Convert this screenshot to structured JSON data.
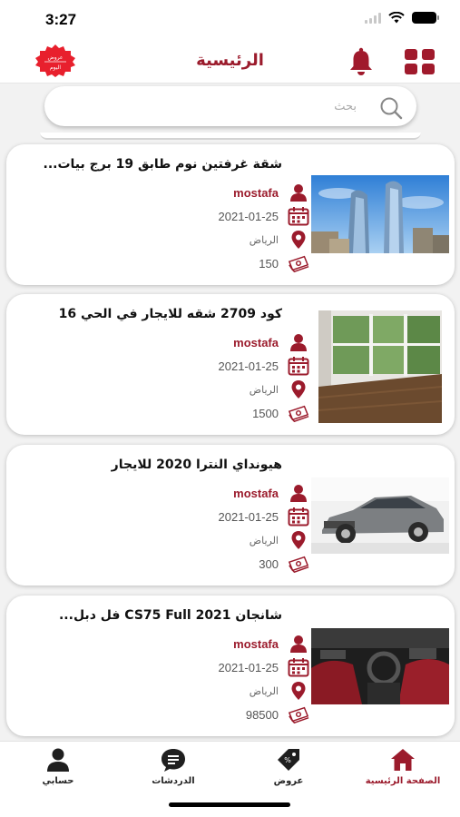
{
  "status": {
    "time": "3:27"
  },
  "header": {
    "title": "الرئيسية",
    "badge_line1": "عروض",
    "badge_line2": "اليوم"
  },
  "search": {
    "placeholder": "بحث"
  },
  "listings": [
    {
      "title": "شقة غرفتين نوم طابق 19 برج بيات...",
      "user": "mostafa",
      "date": "2021-01-25",
      "city": "الرياض",
      "price": "150"
    },
    {
      "title": "كود 2709 شقه للايجار في الحي 16",
      "user": "mostafa",
      "date": "2021-01-25",
      "city": "الرياض",
      "price": "1500"
    },
    {
      "title": "هيونداي النترا 2020 للايجار",
      "user": "mostafa",
      "date": "2021-01-25",
      "city": "الرياض",
      "price": "300"
    },
    {
      "title": "شانجان CS75 Full 2021 فل دبل...",
      "user": "mostafa",
      "date": "2021-01-25",
      "city": "الرياض",
      "price": "98500"
    }
  ],
  "tabs": [
    {
      "label": "الصفحة الرئيسية",
      "icon": "home-icon",
      "active": true
    },
    {
      "label": "عروض",
      "icon": "offers-icon",
      "active": false
    },
    {
      "label": "الدردشات",
      "icon": "chat-icon",
      "active": false
    },
    {
      "label": "حسابي",
      "icon": "account-icon",
      "active": false
    }
  ],
  "colors": {
    "brand": "#9b1b2c",
    "badge": "#e8202d"
  }
}
